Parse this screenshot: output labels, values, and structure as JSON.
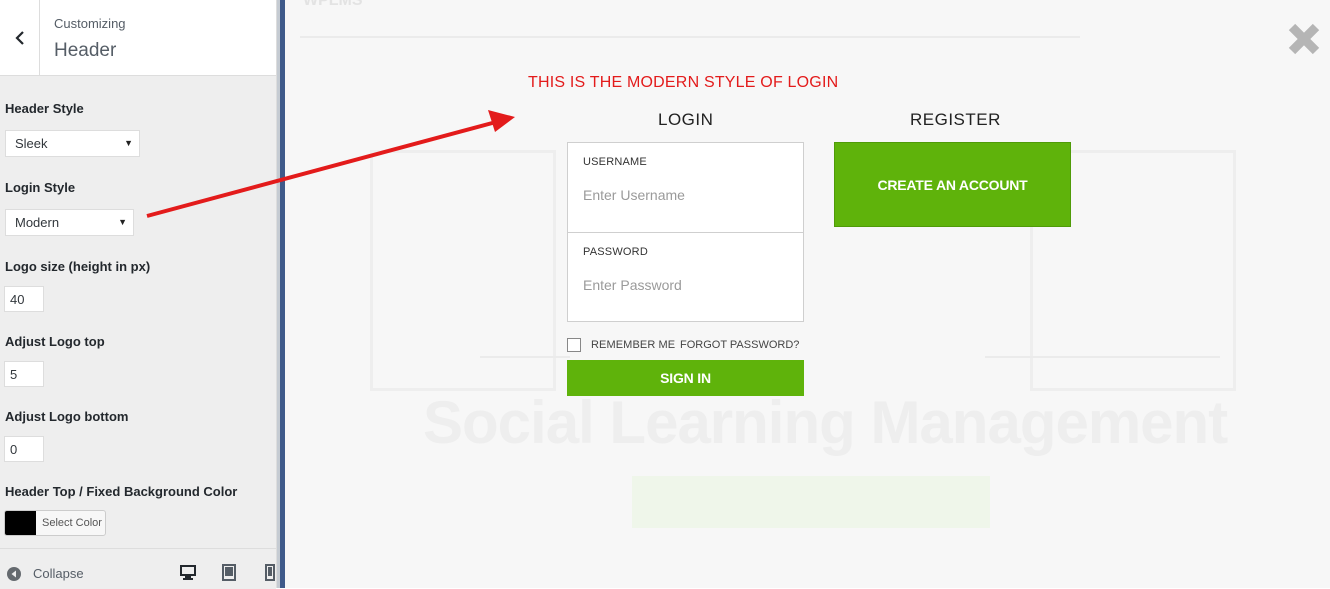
{
  "sidebar": {
    "header": {
      "subtitle": "Customizing",
      "title": "Header"
    },
    "controls": {
      "header_style": {
        "label": "Header Style",
        "value": "Sleek"
      },
      "login_style": {
        "label": "Login Style",
        "value": "Modern"
      },
      "logo_size": {
        "label": "Logo size (height in px)",
        "value": "40"
      },
      "logo_top": {
        "label": "Adjust Logo top",
        "value": "5"
      },
      "logo_bottom": {
        "label": "Adjust Logo bottom",
        "value": "0"
      },
      "bg_color": {
        "label": "Header Top / Fixed Background Color",
        "button_label": "Select Color",
        "swatch_color": "#000000"
      }
    },
    "footer": {
      "collapse_label": "Collapse"
    }
  },
  "preview": {
    "annotation": "THIS IS THE MODERN STYLE OF LOGIN",
    "login": {
      "heading": "LOGIN",
      "username_label": "USERNAME",
      "username_placeholder": "Enter Username",
      "password_label": "PASSWORD",
      "password_placeholder": "Enter Password",
      "remember_label": "REMEMBER ME",
      "forgot_label": "FORGOT PASSWORD?",
      "signin_label": "SIGN IN"
    },
    "register": {
      "heading": "REGISTER",
      "create_label": "CREATE AN ACCOUNT"
    },
    "background": {
      "heading": "Social Learning Management"
    }
  },
  "colors": {
    "accent_green": "#5fb30b",
    "annotation_red": "#e31b1b"
  },
  "icons": [
    "back-arrow-icon",
    "collapse-icon",
    "desktop-icon",
    "tablet-icon",
    "mobile-icon",
    "close-icon"
  ]
}
